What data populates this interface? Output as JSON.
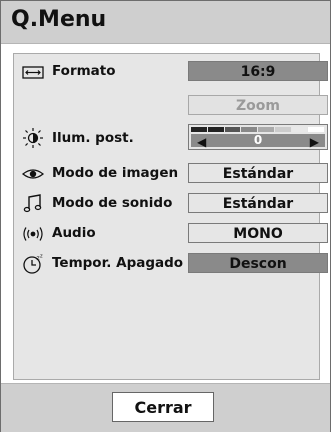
{
  "window": {
    "title": "Q.Menu"
  },
  "items": [
    {
      "icon": "aspect-ratio-icon",
      "label": "Formato",
      "value": "16:9"
    },
    {
      "icon": "",
      "label": "",
      "value": "Zoom"
    },
    {
      "icon": "backlight-icon",
      "label": "Ilum. post.",
      "value": "0"
    },
    {
      "icon": "picture-mode-icon",
      "label": "Modo de imagen",
      "value": "Estándar"
    },
    {
      "icon": "sound-mode-icon",
      "label": "Modo de sonido",
      "value": "Estándar"
    },
    {
      "icon": "audio-icon",
      "label": "Audio",
      "value": "MONO"
    },
    {
      "icon": "sleep-timer-icon",
      "label": "Tempor. Apagado",
      "value": "Descon"
    }
  ],
  "backlight": {
    "level": 0,
    "scale_segments": [
      "#222222",
      "#222222",
      "#555555",
      "#888888",
      "#aaaaaa",
      "#cccccc",
      "#e8e8e8",
      "#ffffff"
    ]
  },
  "footer": {
    "close_label": "Cerrar"
  }
}
